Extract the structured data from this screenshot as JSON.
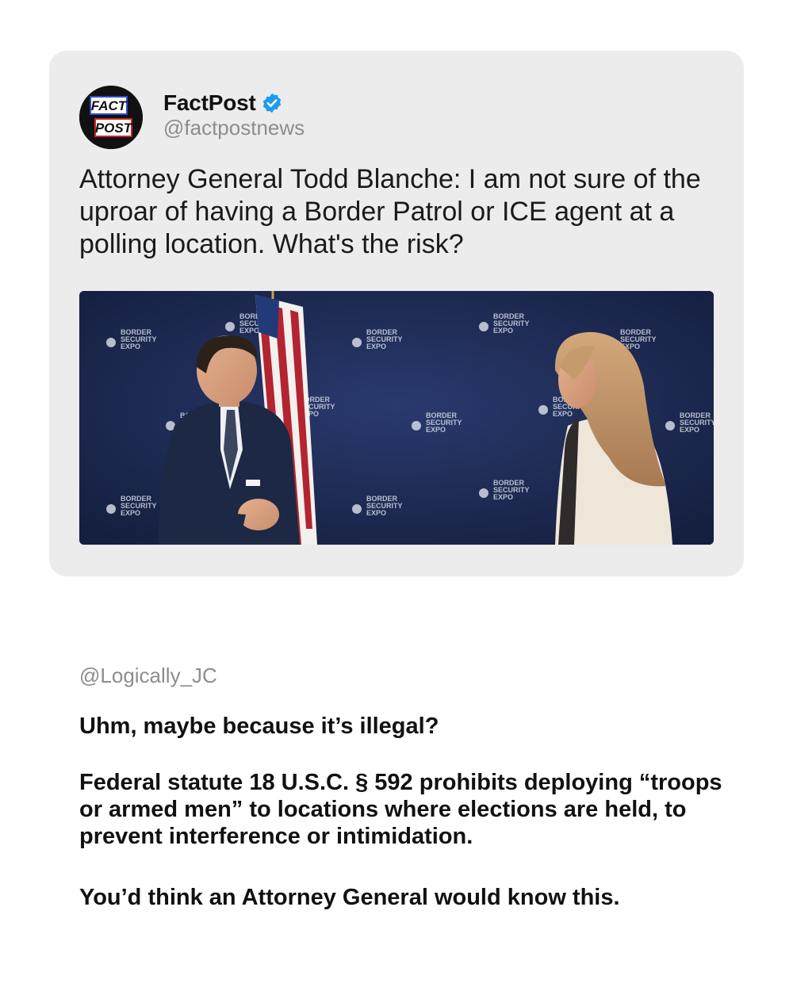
{
  "tweet": {
    "author_name": "FactPost",
    "handle": "@factpostnews",
    "avatar_text": [
      "FACT",
      "POST"
    ],
    "text": "Attorney General Todd Blanche: I am not sure of the uproar of having a Border Patrol or ICE agent at a polling location. What's the risk?",
    "verified_color": "#1d9bf0",
    "backdrop_text": [
      "BORDER",
      "SECURITY",
      "EXPO"
    ]
  },
  "reply": {
    "handle": "@Logically_JC",
    "paragraphs": [
      "Uhm, maybe because it’s illegal?",
      "Federal statute 18 U.S.C. § 592 prohibits deploying “troops or armed men” to locations where elections are held, to prevent interference or intimidation.",
      "You’d think an Attorney General would know this."
    ]
  },
  "colors": {
    "card_bg": "#ececec",
    "backdrop_blue": "#1b2850",
    "handle_gray": "#8d8d8d"
  }
}
